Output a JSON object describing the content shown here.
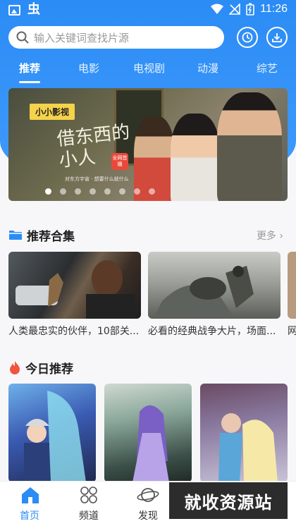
{
  "status_bar": {
    "time": "11:26",
    "app_glyph": "虫"
  },
  "search": {
    "placeholder": "输入关键词查找片源"
  },
  "tabs": [
    {
      "label": "推荐",
      "active": true
    },
    {
      "label": "电影"
    },
    {
      "label": "电视剧"
    },
    {
      "label": "动漫"
    },
    {
      "label": "综艺"
    }
  ],
  "banner": {
    "logo": "小小影视",
    "title": "借东西的小人",
    "badge": "全网首播",
    "strip": "对东方宇宙 · 想要什么就什么",
    "dot_count": 8,
    "active_dot": 0
  },
  "collections": {
    "title": "推荐合集",
    "more": "更多",
    "items": [
      {
        "caption": "人类最忠实的伙伴，10部关..."
      },
      {
        "caption": "必看的经典战争大片，场面..."
      },
      {
        "caption": "网"
      }
    ]
  },
  "today": {
    "title": "今日推荐"
  },
  "bottom_nav": [
    {
      "label": "首页",
      "icon": "home-icon",
      "active": true
    },
    {
      "label": "频道",
      "icon": "channel-icon"
    },
    {
      "label": "发现",
      "icon": "planet-icon"
    }
  ],
  "watermark": "就收资源站",
  "colors": {
    "primary": "#2b8cf5",
    "accent_red": "#f0533f"
  }
}
